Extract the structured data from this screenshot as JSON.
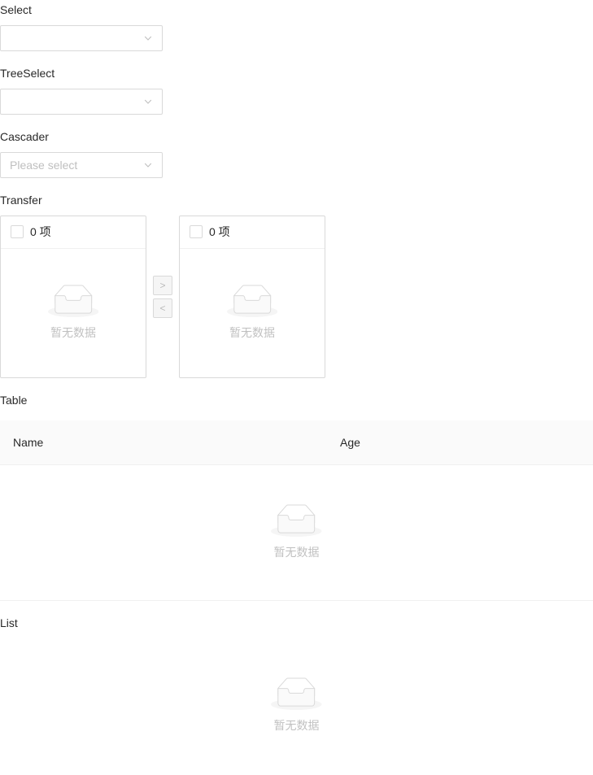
{
  "sections": {
    "select": {
      "label": "Select",
      "value": ""
    },
    "tree_select": {
      "label": "TreeSelect",
      "value": ""
    },
    "cascader": {
      "label": "Cascader",
      "value": "",
      "placeholder": "Please select"
    },
    "transfer": {
      "label": "Transfer",
      "source": {
        "count_label": "0 项",
        "empty_text": "暂无数据",
        "checkbox_checked": false
      },
      "target": {
        "count_label": "0 项",
        "empty_text": "暂无数据",
        "checkbox_checked": false
      },
      "operations": {
        "to_right_disabled": true,
        "to_left_disabled": true
      }
    },
    "table": {
      "label": "Table",
      "columns": [
        "Name",
        "Age"
      ],
      "rows": [],
      "empty_text": "暂无数据"
    },
    "list": {
      "label": "List",
      "items": [],
      "empty_text": "暂无数据"
    }
  },
  "icons": {
    "chevron_down_icon": "∨",
    "chevron_right_icon": ">",
    "chevron_left_icon": "<",
    "empty_inbox_icon": "inbox-tray"
  },
  "colors": {
    "border": "#d9d9d9",
    "divider": "#f0f0f0",
    "table_header_bg": "#fafafa",
    "disabled_bg": "#f5f5f5",
    "placeholder_text": "#bfbfbf",
    "empty_text": "rgba(0,0,0,0.25)",
    "label_text": "rgba(0,0,0,0.85)",
    "empty_image_fill": "#fafafa",
    "empty_image_stroke": "#d9d9d9",
    "empty_image_shadow": "#f5f5f5"
  }
}
